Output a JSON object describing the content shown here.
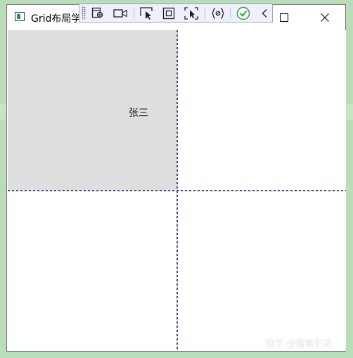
{
  "window": {
    "title": "Grid布局学"
  },
  "debug_toolbar": {
    "items": [
      {
        "icon": "live-visual-tree-icon"
      },
      {
        "icon": "video-camera-icon"
      },
      {
        "icon": "select-element-icon"
      },
      {
        "icon": "display-layout-adorners-icon"
      },
      {
        "icon": "track-focus-icon"
      },
      {
        "icon": "binding-failures-icon"
      },
      {
        "icon": "accessibility-check-icon"
      },
      {
        "icon": "collapse-chevron-icon"
      }
    ]
  },
  "grid": {
    "cell_text": "张三"
  },
  "watermark": "知乎 @落笔生花",
  "colors": {
    "desktop_bg": "#b9dcb9",
    "cell_bg": "#dedede",
    "grid_line_blue": "#3b4bc8",
    "grid_line_yellow": "#f4e7a0",
    "toolbar_bg": "#eef1fb",
    "check_green": "#2ea043"
  }
}
